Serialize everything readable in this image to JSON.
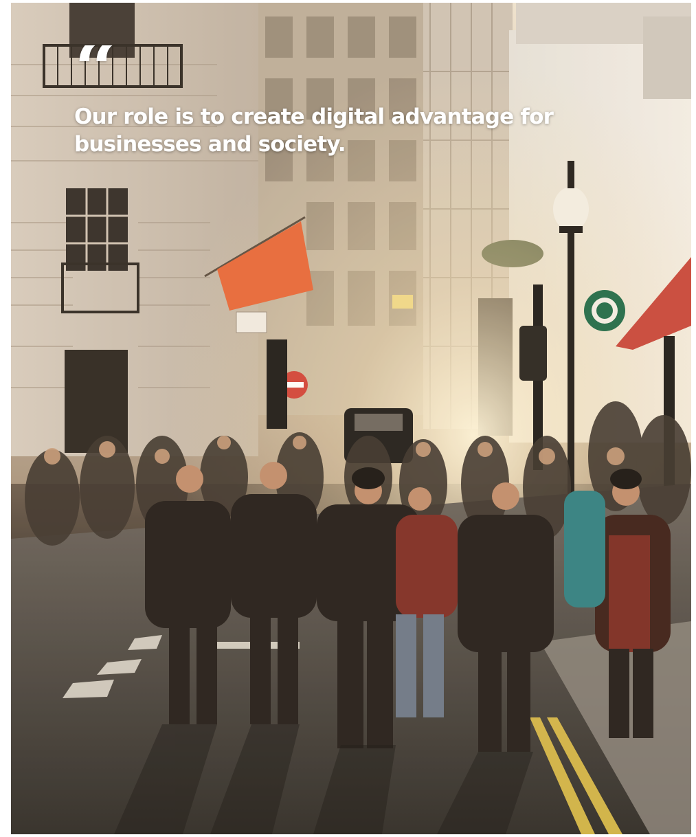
{
  "quote": {
    "mark": "“",
    "line1": "Our role is to create digital advantage for",
    "line2": "businesses and society."
  },
  "scene": {
    "description_icons": [
      "flag-icon",
      "street-lamp-icon",
      "traffic-light-icon",
      "no-entry-sign-icon",
      "taxi-icon",
      "starbucks-logo"
    ],
    "colors": {
      "flag": "#e8683a",
      "awning": "#c8463b",
      "sunlight": "#fff1cf"
    }
  }
}
